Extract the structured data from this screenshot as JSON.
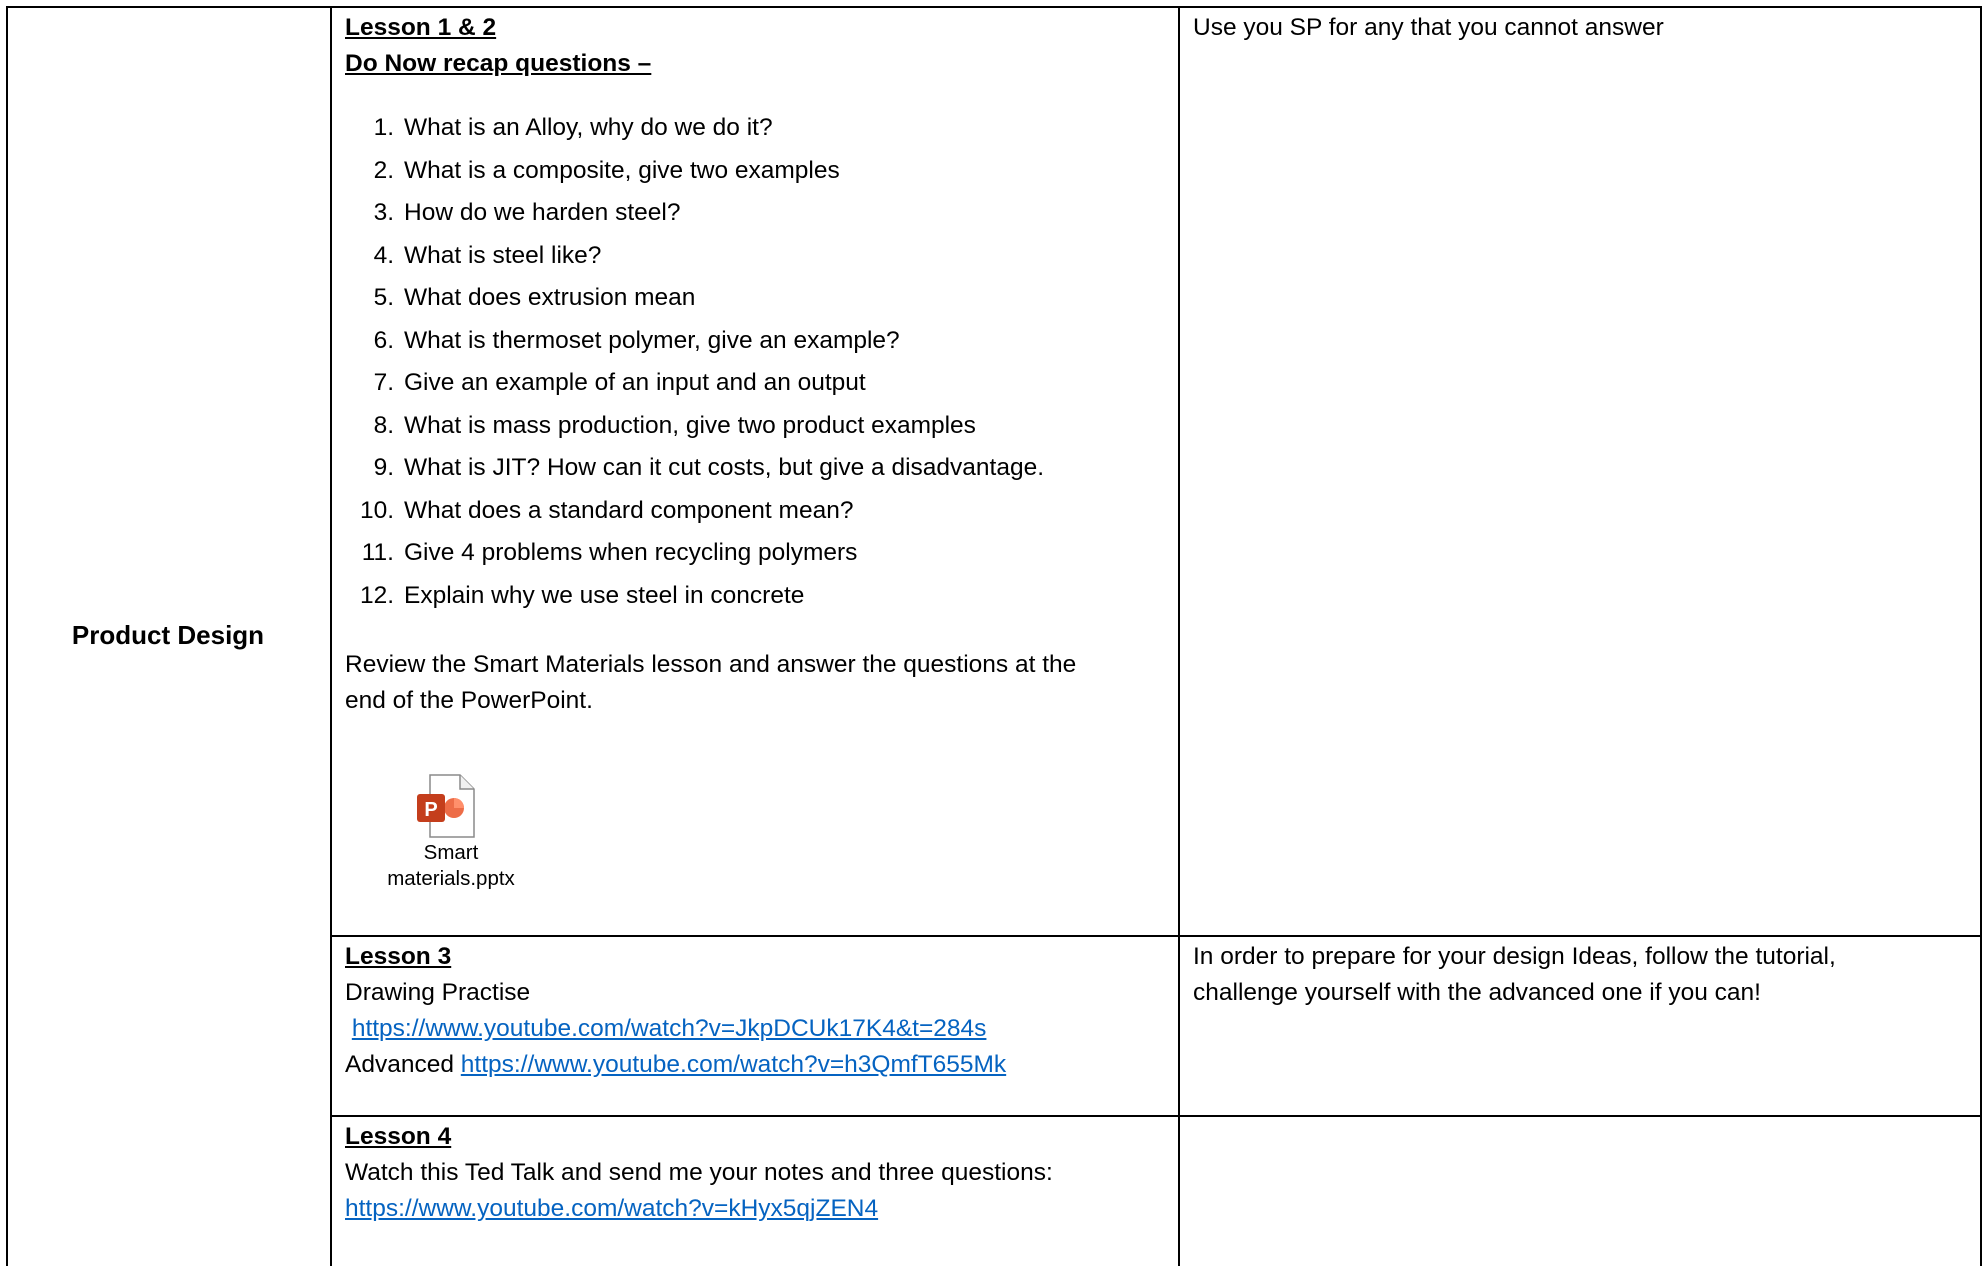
{
  "subject": "Product Design",
  "lesson12": {
    "title": "Lesson 1 & 2",
    "subtitle": "Do Now recap questions –",
    "questions": [
      {
        "num": "1.",
        "text": "What is an Alloy, why do we do it?"
      },
      {
        "num": "2.",
        "text": "What is a composite, give two examples"
      },
      {
        "num": "3.",
        "text": "How do we harden steel?"
      },
      {
        "num": "4.",
        "text": "What is steel like?"
      },
      {
        "num": "5.",
        "text": "What does extrusion mean"
      },
      {
        "num": "6.",
        "text": "What is thermoset polymer, give an example?"
      },
      {
        "num": "7.",
        "text": "Give an example of an input and an output"
      },
      {
        "num": "8.",
        "text": "What is mass production, give two product examples"
      },
      {
        "num": "9.",
        "text": "What is JIT? How can it cut costs, but give a disadvantage."
      },
      {
        "num": "10.",
        "text": "What does a standard component mean?"
      },
      {
        "num": "11.",
        "text": "Give 4 problems when recycling polymers"
      },
      {
        "num": "12.",
        "text": "Explain why we use steel in concrete"
      }
    ],
    "review_line1": "Review the Smart Materials lesson and answer the questions at the",
    "review_line2": "end of the PowerPoint.",
    "file_label_line1": "Smart",
    "file_label_line2": "materials.pptx",
    "file_icon": "powerpoint-file-icon",
    "note": "Use you SP for any that you cannot answer"
  },
  "lesson3": {
    "title": "Lesson 3",
    "drawing": "Drawing Practise",
    "link1": "https://www.youtube.com/watch?v=JkpDCUk17K4&t=284s",
    "advanced_label": "Advanced",
    "link2": "https://www.youtube.com/watch?v=h3QmfT655Mk",
    "note_line1": "In order to prepare for your design Ideas, follow the tutorial,",
    "note_line2": "challenge yourself with the advanced one if you can!"
  },
  "lesson4": {
    "title": "Lesson 4",
    "text": "Watch this Ted Talk and send me your notes and three questions:",
    "link": "https://www.youtube.com/watch?v=kHyx5qjZEN4"
  },
  "colors": {
    "link": "#0563c1",
    "ppt_icon": "#c43e1c"
  }
}
